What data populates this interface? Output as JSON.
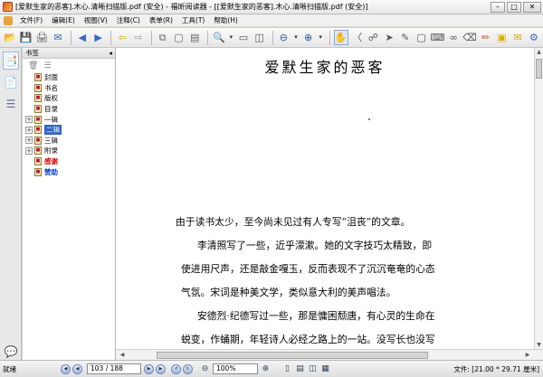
{
  "window": {
    "title": "[爱默生家的恶客].木心.清晰扫描版.pdf (安全) - 福昕阅读器 - [[爱默生家的恶客].木心.清晰扫描版.pdf (安全)]",
    "minimize": "–",
    "maximize": "□",
    "close": "✕"
  },
  "menu": {
    "items": [
      "文件(F)",
      "编辑(E)",
      "视图(V)",
      "注释(C)",
      "表单(R)",
      "工具(T)",
      "帮助(H)"
    ]
  },
  "bookmarks": {
    "header": "书签",
    "collapse": "◂",
    "items": [
      {
        "label": "封面",
        "expand": ""
      },
      {
        "label": "书名",
        "expand": ""
      },
      {
        "label": "版权",
        "expand": ""
      },
      {
        "label": "目录",
        "expand": ""
      },
      {
        "label": "一辑",
        "expand": "+"
      },
      {
        "label": "二辑",
        "expand": "+"
      },
      {
        "label": "三辑",
        "expand": "+"
      },
      {
        "label": "附录",
        "expand": "+"
      },
      {
        "label": "感谢",
        "expand": ""
      },
      {
        "label": "赞助",
        "expand": ""
      }
    ]
  },
  "document": {
    "title": "爱默生家的恶客",
    "lines": [
      "由于读书太少，至今尚未见过有人专写“沮丧”的文章。",
      "李清照写了一些，近乎濛漱。她的文字技巧太精致，即",
      "使进用尺声，还是敲金嘎玉，反而表现不了沉沉奄奄的心态",
      "气氛。宋词是种美文学，类似意大利的美声唱法。",
      "安德烈·纪德写过一些，那是慵困颓唐，有心灵的生命在",
      "蜕变，作蛹期，年轻诗人必经之路上的一站。没写长也没写"
    ]
  },
  "statusbar": {
    "ready": "就绪",
    "page": "103 / 188",
    "zoom": "100%",
    "doc_size": "文件: [21.00 * 29.71 厘米]"
  },
  "colors": {
    "selection": "#3163c5",
    "bookmark_red": "#d10000",
    "bookmark_blue": "#0033cc"
  }
}
